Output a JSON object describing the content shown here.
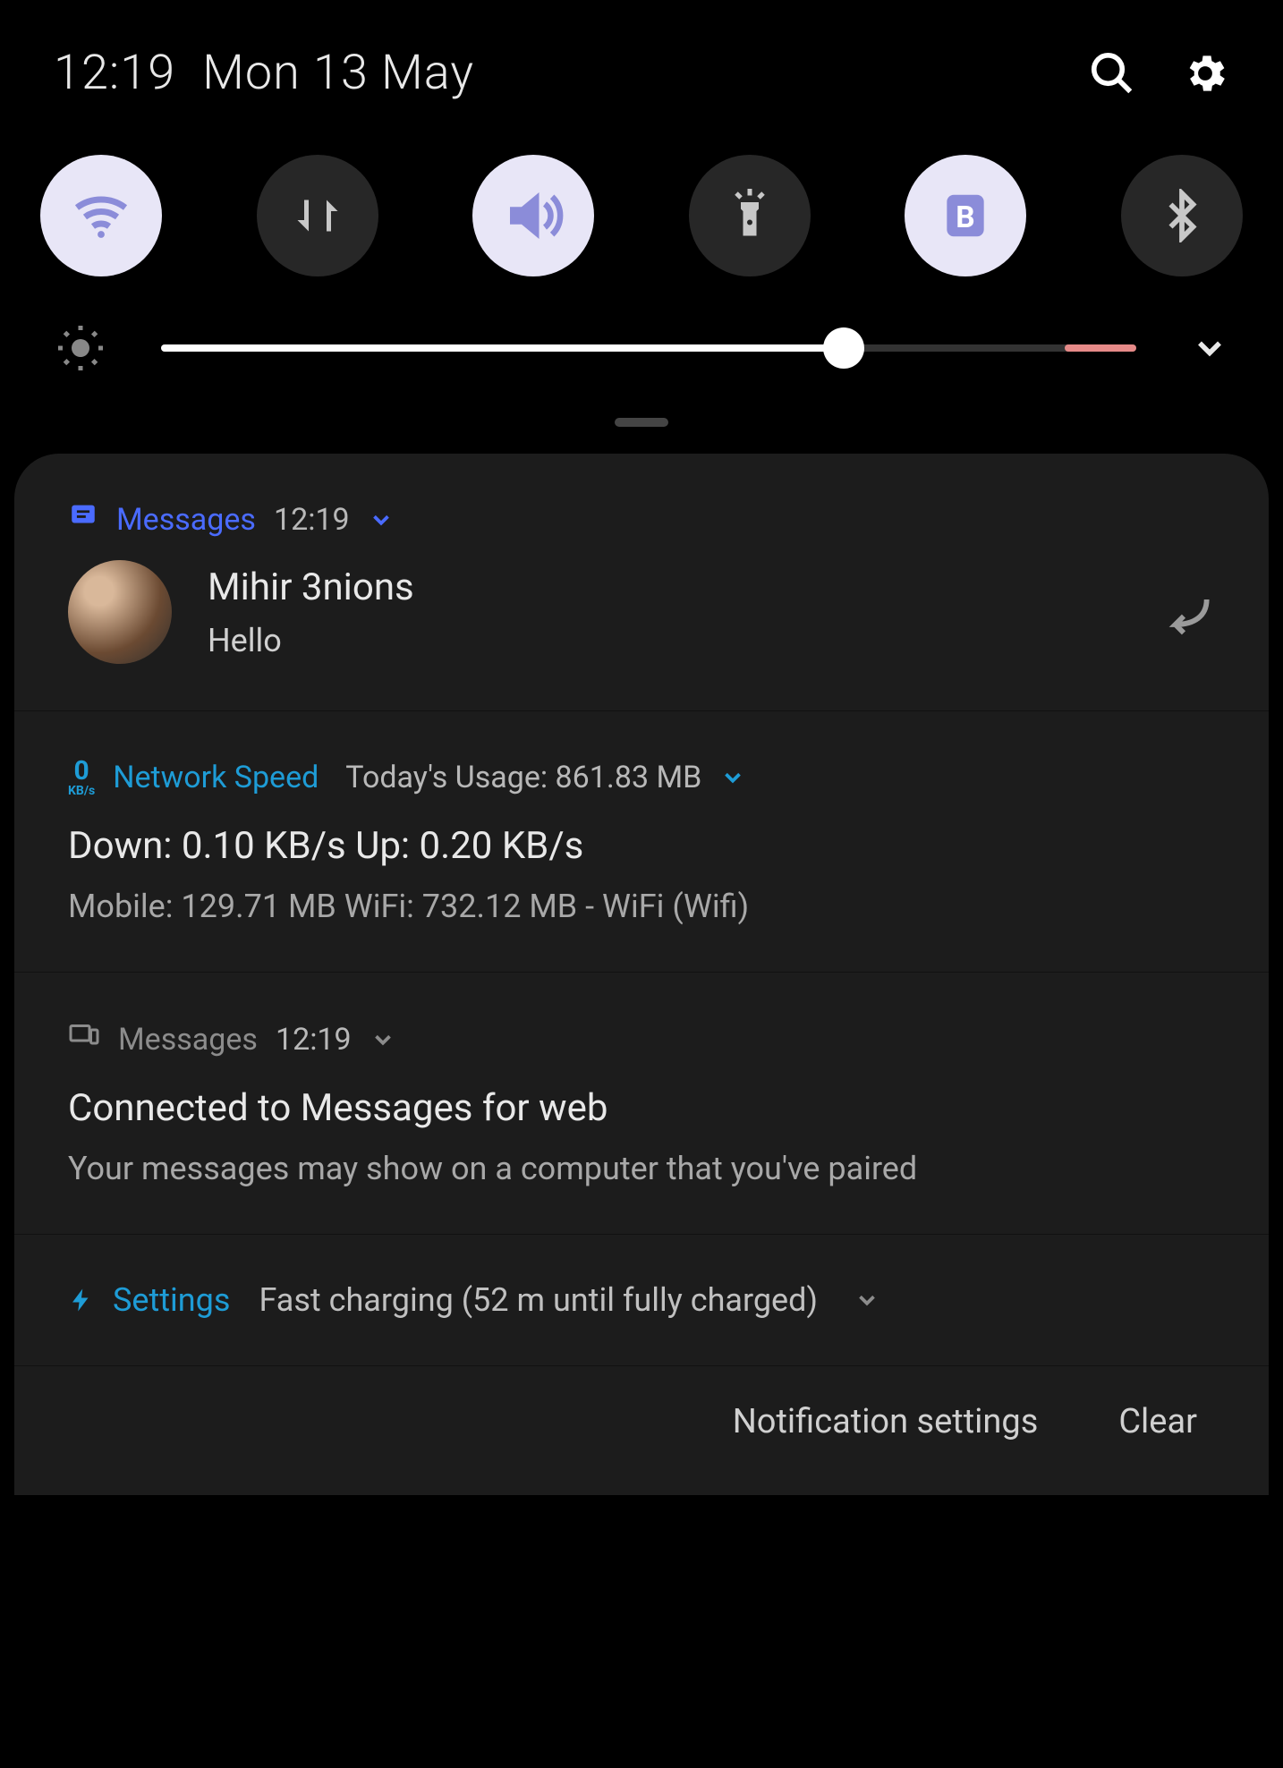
{
  "header": {
    "time": "12:19",
    "date": "Mon 13 May"
  },
  "toggles": [
    {
      "name": "wifi",
      "on": true
    },
    {
      "name": "mobile-data",
      "on": false
    },
    {
      "name": "sound",
      "on": true
    },
    {
      "name": "flashlight",
      "on": false
    },
    {
      "name": "blue-light",
      "on": true
    },
    {
      "name": "bluetooth",
      "on": false
    }
  ],
  "brightness_percent": 70,
  "notifications": {
    "messages": {
      "app": "Messages",
      "time": "12:19",
      "sender": "Mihir 3nions",
      "preview": "Hello"
    },
    "network": {
      "app": "Network Speed",
      "kb_icon_num": "0",
      "kb_icon_unit": "KB/s",
      "subtitle": "Today's Usage: 861.83 MB",
      "line1": "Down: 0.10 KB/s Up: 0.20 KB/s",
      "line2": "Mobile: 129.71 MB  WiFi: 732.12 MB  - WiFi (Wifi)"
    },
    "messages_web": {
      "app": "Messages",
      "time": "12:19",
      "title": "Connected to Messages for web",
      "sub": "Your messages may show on a computer that you've paired"
    },
    "settings": {
      "app": "Settings",
      "msg": "Fast charging (52 m until fully charged)"
    }
  },
  "footer": {
    "settings": "Notification settings",
    "clear": "Clear"
  }
}
